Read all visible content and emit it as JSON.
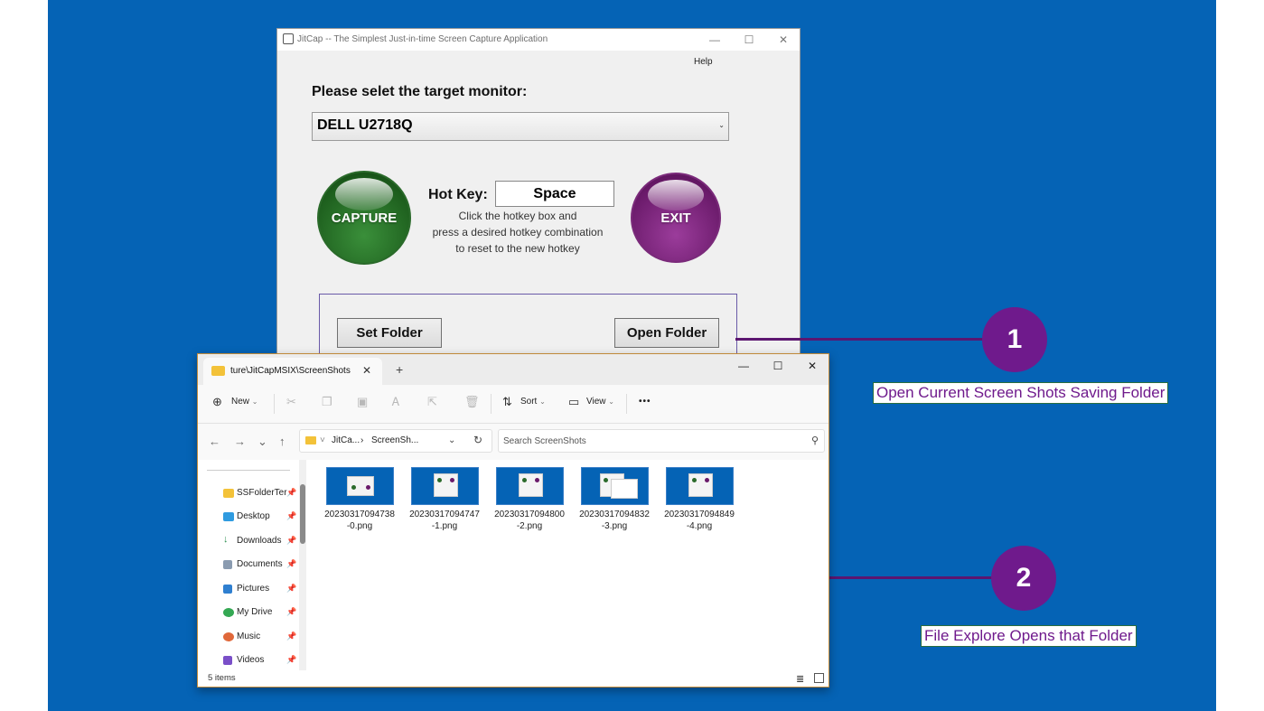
{
  "jitcap": {
    "title": "JitCap -- The Simplest Just-in-time Screen Capture Application",
    "help": "Help",
    "prompt": "Please selet the target monitor:",
    "monitor_selected": "DELL U2718Q",
    "capture_label": "CAPTURE",
    "exit_label": "EXIT",
    "hotkey_label": "Hot Key:",
    "hotkey_value": "Space",
    "hotkey_help_1": "Click the hotkey box and",
    "hotkey_help_2": "press a desired hotkey combination",
    "hotkey_help_3": "to reset to the new hotkey",
    "set_folder": "Set Folder",
    "open_folder": "Open Folder",
    "controls": {
      "minimize": "—",
      "maximize": "☐",
      "close": "✕"
    },
    "accent_capture": "#1d5e1d",
    "accent_exit": "#6a1a6a"
  },
  "explorer": {
    "tab_title": "ture\\JitCapMSIX\\ScreenShots",
    "tab_close": "✕",
    "new_tab": "+",
    "controls": {
      "minimize": "—",
      "maximize": "☐",
      "close": "✕"
    },
    "toolbar": {
      "new": "New",
      "sort": "Sort",
      "view": "View",
      "more": "•••"
    },
    "nav": {
      "back": "←",
      "forward": "→",
      "recent": "⌄",
      "up": "↑"
    },
    "breadcrumb": [
      "JitCa...",
      "ScreenSh..."
    ],
    "breadcrumb_sep": "›",
    "search_placeholder": "Search ScreenShots",
    "sidebar": [
      {
        "label": "SSFolderTer",
        "icon": "folder-icon",
        "color": "#f3c239"
      },
      {
        "label": "Desktop",
        "icon": "desktop-icon",
        "color": "#2f9be0"
      },
      {
        "label": "Downloads",
        "icon": "download-icon",
        "color": "#2c8f50"
      },
      {
        "label": "Documents",
        "icon": "document-icon",
        "color": "#8a9bb0"
      },
      {
        "label": "Pictures",
        "icon": "pictures-icon",
        "color": "#2f7fd0"
      },
      {
        "label": "My Drive",
        "icon": "drive-icon",
        "color": "#34a853"
      },
      {
        "label": "Music",
        "icon": "music-icon",
        "color": "#e0683a"
      },
      {
        "label": "Videos",
        "icon": "videos-icon",
        "color": "#7a4fc8"
      }
    ],
    "files": [
      {
        "line1": "20230317094738",
        "line2": "-0.png"
      },
      {
        "line1": "20230317094747",
        "line2": "-1.png"
      },
      {
        "line1": "20230317094800",
        "line2": "-2.png"
      },
      {
        "line1": "20230317094832",
        "line2": "-3.png"
      },
      {
        "line1": "20230317094849",
        "line2": "-4.png"
      }
    ],
    "status": "5 items"
  },
  "callouts": [
    {
      "number": "1",
      "text": "Open Current Screen Shots Saving Folder"
    },
    {
      "number": "2",
      "text": "File Explore Opens that Folder"
    }
  ],
  "colors": {
    "background": "#0563b5",
    "callout_fill": "#6f1a8c",
    "callout_border": "#2a6e3e"
  }
}
